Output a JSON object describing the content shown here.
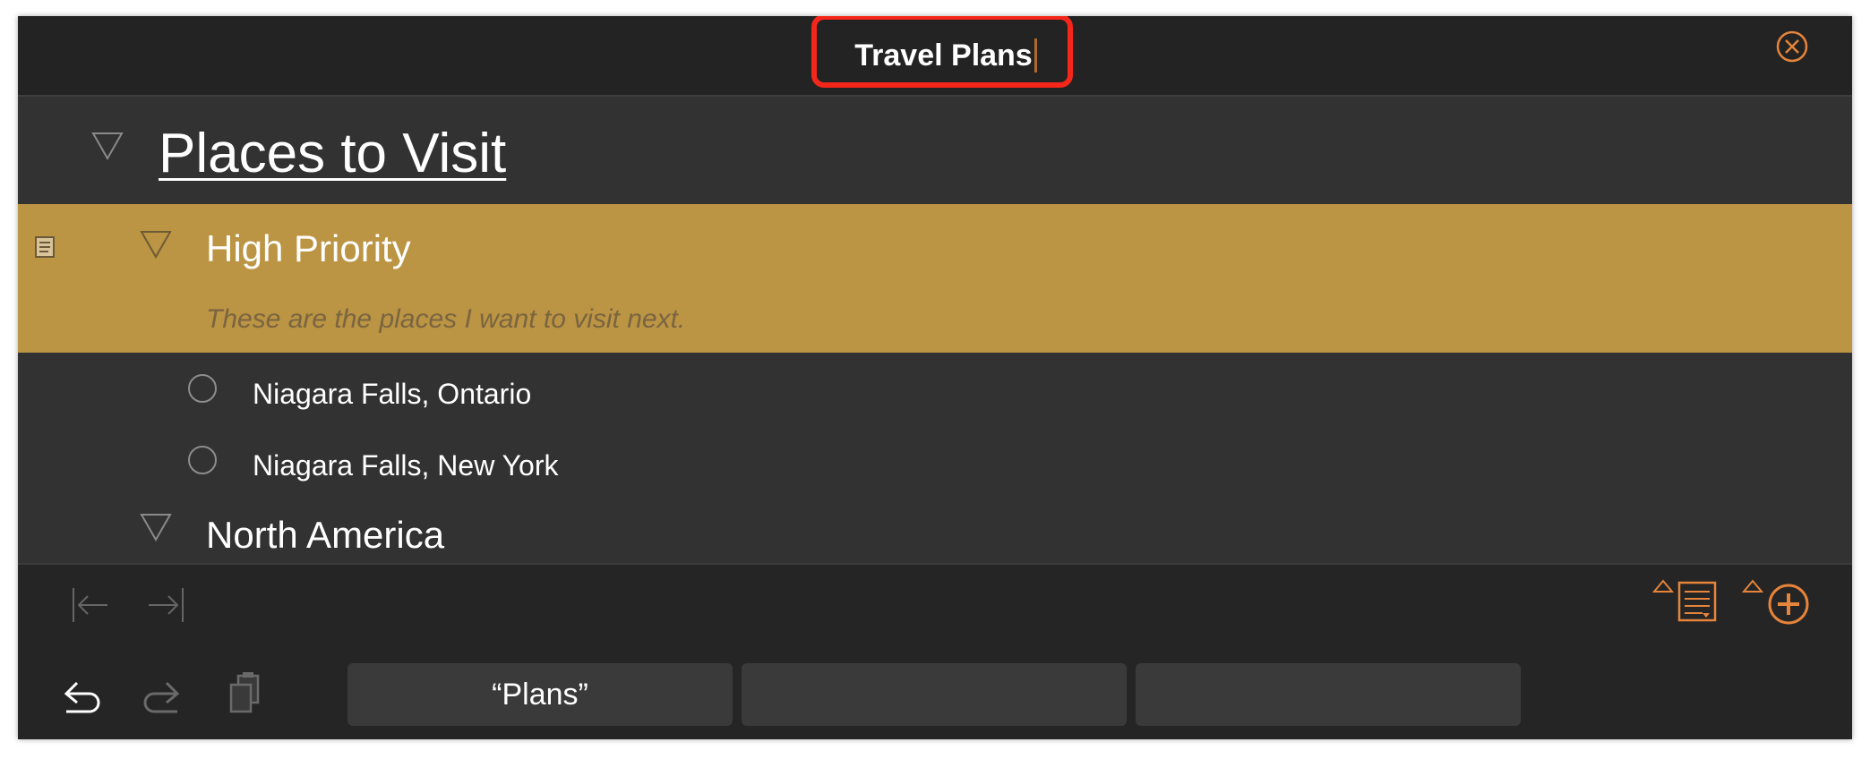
{
  "document": {
    "title": "Travel Plans"
  },
  "outline": {
    "heading": "Places to Visit",
    "selected_row": {
      "title": "High Priority",
      "note": "These are the places I want to visit next."
    },
    "items": [
      {
        "label": "Niagara Falls, Ontario"
      },
      {
        "label": "Niagara Falls, New York"
      }
    ],
    "next_group": "North America"
  },
  "toolbar": {
    "suggestions": [
      "“Plans”",
      "",
      ""
    ]
  },
  "icons": {
    "close": "close-circle-icon",
    "collapse": "disclosure-triangle-icon",
    "note": "note-icon",
    "checkbox": "status-circle-icon",
    "outdent": "outdent-icon",
    "indent": "indent-icon",
    "add_note": "add-note-icon",
    "add_row": "add-row-icon",
    "undo": "undo-icon",
    "redo": "redo-icon",
    "paste": "clipboard-icon"
  },
  "colors": {
    "accent": "#e5843a",
    "selection": "#bb9444",
    "highlight_box": "#f4271a"
  }
}
